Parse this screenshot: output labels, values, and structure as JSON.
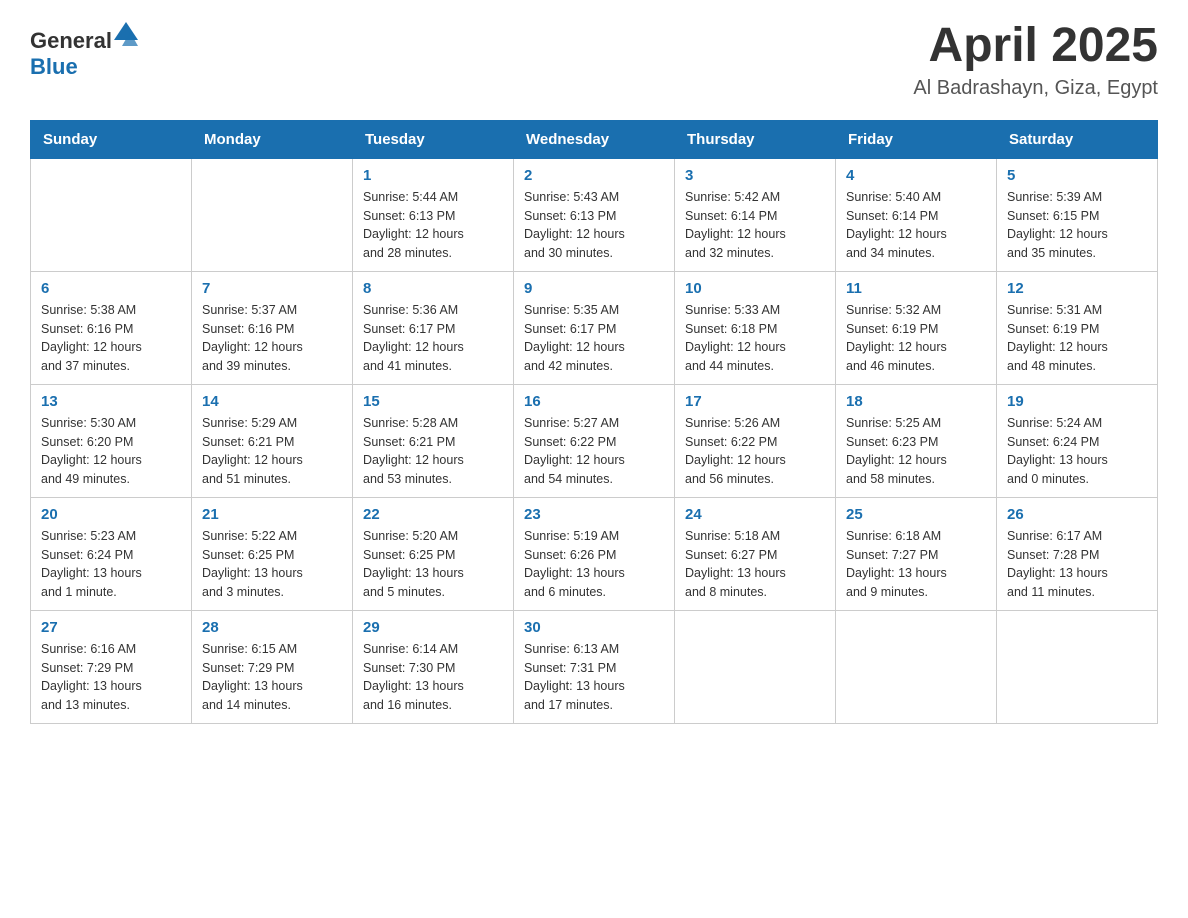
{
  "header": {
    "logo_general": "General",
    "logo_blue": "Blue",
    "month_title": "April 2025",
    "location": "Al Badrashayn, Giza, Egypt"
  },
  "days_of_week": [
    "Sunday",
    "Monday",
    "Tuesday",
    "Wednesday",
    "Thursday",
    "Friday",
    "Saturday"
  ],
  "weeks": [
    [
      {
        "day": "",
        "info": ""
      },
      {
        "day": "",
        "info": ""
      },
      {
        "day": "1",
        "info": "Sunrise: 5:44 AM\nSunset: 6:13 PM\nDaylight: 12 hours\nand 28 minutes."
      },
      {
        "day": "2",
        "info": "Sunrise: 5:43 AM\nSunset: 6:13 PM\nDaylight: 12 hours\nand 30 minutes."
      },
      {
        "day": "3",
        "info": "Sunrise: 5:42 AM\nSunset: 6:14 PM\nDaylight: 12 hours\nand 32 minutes."
      },
      {
        "day": "4",
        "info": "Sunrise: 5:40 AM\nSunset: 6:14 PM\nDaylight: 12 hours\nand 34 minutes."
      },
      {
        "day": "5",
        "info": "Sunrise: 5:39 AM\nSunset: 6:15 PM\nDaylight: 12 hours\nand 35 minutes."
      }
    ],
    [
      {
        "day": "6",
        "info": "Sunrise: 5:38 AM\nSunset: 6:16 PM\nDaylight: 12 hours\nand 37 minutes."
      },
      {
        "day": "7",
        "info": "Sunrise: 5:37 AM\nSunset: 6:16 PM\nDaylight: 12 hours\nand 39 minutes."
      },
      {
        "day": "8",
        "info": "Sunrise: 5:36 AM\nSunset: 6:17 PM\nDaylight: 12 hours\nand 41 minutes."
      },
      {
        "day": "9",
        "info": "Sunrise: 5:35 AM\nSunset: 6:17 PM\nDaylight: 12 hours\nand 42 minutes."
      },
      {
        "day": "10",
        "info": "Sunrise: 5:33 AM\nSunset: 6:18 PM\nDaylight: 12 hours\nand 44 minutes."
      },
      {
        "day": "11",
        "info": "Sunrise: 5:32 AM\nSunset: 6:19 PM\nDaylight: 12 hours\nand 46 minutes."
      },
      {
        "day": "12",
        "info": "Sunrise: 5:31 AM\nSunset: 6:19 PM\nDaylight: 12 hours\nand 48 minutes."
      }
    ],
    [
      {
        "day": "13",
        "info": "Sunrise: 5:30 AM\nSunset: 6:20 PM\nDaylight: 12 hours\nand 49 minutes."
      },
      {
        "day": "14",
        "info": "Sunrise: 5:29 AM\nSunset: 6:21 PM\nDaylight: 12 hours\nand 51 minutes."
      },
      {
        "day": "15",
        "info": "Sunrise: 5:28 AM\nSunset: 6:21 PM\nDaylight: 12 hours\nand 53 minutes."
      },
      {
        "day": "16",
        "info": "Sunrise: 5:27 AM\nSunset: 6:22 PM\nDaylight: 12 hours\nand 54 minutes."
      },
      {
        "day": "17",
        "info": "Sunrise: 5:26 AM\nSunset: 6:22 PM\nDaylight: 12 hours\nand 56 minutes."
      },
      {
        "day": "18",
        "info": "Sunrise: 5:25 AM\nSunset: 6:23 PM\nDaylight: 12 hours\nand 58 minutes."
      },
      {
        "day": "19",
        "info": "Sunrise: 5:24 AM\nSunset: 6:24 PM\nDaylight: 13 hours\nand 0 minutes."
      }
    ],
    [
      {
        "day": "20",
        "info": "Sunrise: 5:23 AM\nSunset: 6:24 PM\nDaylight: 13 hours\nand 1 minute."
      },
      {
        "day": "21",
        "info": "Sunrise: 5:22 AM\nSunset: 6:25 PM\nDaylight: 13 hours\nand 3 minutes."
      },
      {
        "day": "22",
        "info": "Sunrise: 5:20 AM\nSunset: 6:25 PM\nDaylight: 13 hours\nand 5 minutes."
      },
      {
        "day": "23",
        "info": "Sunrise: 5:19 AM\nSunset: 6:26 PM\nDaylight: 13 hours\nand 6 minutes."
      },
      {
        "day": "24",
        "info": "Sunrise: 5:18 AM\nSunset: 6:27 PM\nDaylight: 13 hours\nand 8 minutes."
      },
      {
        "day": "25",
        "info": "Sunrise: 6:18 AM\nSunset: 7:27 PM\nDaylight: 13 hours\nand 9 minutes."
      },
      {
        "day": "26",
        "info": "Sunrise: 6:17 AM\nSunset: 7:28 PM\nDaylight: 13 hours\nand 11 minutes."
      }
    ],
    [
      {
        "day": "27",
        "info": "Sunrise: 6:16 AM\nSunset: 7:29 PM\nDaylight: 13 hours\nand 13 minutes."
      },
      {
        "day": "28",
        "info": "Sunrise: 6:15 AM\nSunset: 7:29 PM\nDaylight: 13 hours\nand 14 minutes."
      },
      {
        "day": "29",
        "info": "Sunrise: 6:14 AM\nSunset: 7:30 PM\nDaylight: 13 hours\nand 16 minutes."
      },
      {
        "day": "30",
        "info": "Sunrise: 6:13 AM\nSunset: 7:31 PM\nDaylight: 13 hours\nand 17 minutes."
      },
      {
        "day": "",
        "info": ""
      },
      {
        "day": "",
        "info": ""
      },
      {
        "day": "",
        "info": ""
      }
    ]
  ]
}
